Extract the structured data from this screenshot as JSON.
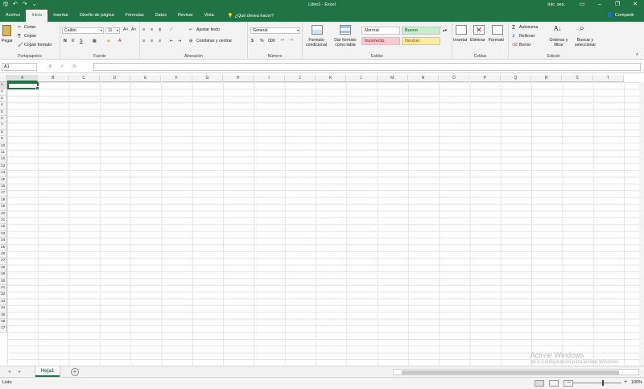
{
  "window": {
    "title": "Libro1  -  Excel",
    "user": "Inic. ses."
  },
  "tabs": [
    {
      "label": "Archivo"
    },
    {
      "label": "Inicio"
    },
    {
      "label": "Insertar"
    },
    {
      "label": "Diseño de página"
    },
    {
      "label": "Fórmulas"
    },
    {
      "label": "Datos"
    },
    {
      "label": "Revisar"
    },
    {
      "label": "Vista"
    }
  ],
  "tellme": "¿Qué desea hacer?",
  "share": "Compartir",
  "ribbon": {
    "clipboard": {
      "paste": "Pegar",
      "cut": "Cortar",
      "copy": "Copiar",
      "format_painter": "Copiar formato",
      "label": "Portapapeles"
    },
    "font": {
      "name": "Calibri",
      "size": "11",
      "bold": "N",
      "italic": "K",
      "underline": "S",
      "label": "Fuente"
    },
    "alignment": {
      "wrap": "Ajustar texto",
      "merge": "Combinar y centrar",
      "label": "Alineación"
    },
    "number": {
      "format": "General",
      "currency": "$",
      "percent": "%",
      "thousands": "000",
      "label": "Número"
    },
    "styles": {
      "cond_format": "Formato condicional",
      "table_format": "Dar formato como tabla",
      "normal": "Normal",
      "good": "Bueno",
      "bad": "Incorrecto",
      "neutral": "Neutral",
      "label": "Estilos"
    },
    "cells": {
      "insert": "Insertar",
      "delete": "Eliminar",
      "format": "Formato",
      "label": "Celdas"
    },
    "editing": {
      "autosum": "Autosuma",
      "fill": "Rellenar",
      "clear": "Borrar",
      "sort": "Ordenar y filtrar",
      "find": "Buscar y seleccionar",
      "label": "Edición"
    }
  },
  "colors": {
    "brand": "#217346",
    "good_bg": "#c6efce",
    "bad_bg": "#ffc7ce",
    "neutral_bg": "#ffeb9c"
  },
  "formula_bar": {
    "name_box": "A1",
    "cancel": "✕",
    "enter": "✓",
    "fx": "fx",
    "value": ""
  },
  "columns": [
    "A",
    "B",
    "C",
    "D",
    "E",
    "F",
    "G",
    "H",
    "I",
    "J",
    "K",
    "L",
    "M",
    "N",
    "O",
    "P",
    "Q",
    "R",
    "S",
    "T"
  ],
  "rows": [
    "1",
    "2",
    "3",
    "4",
    "5",
    "6",
    "7",
    "8",
    "9",
    "10",
    "11",
    "12",
    "13",
    "14",
    "15",
    "16",
    "17",
    "18",
    "19",
    "20",
    "21",
    "22",
    "23",
    "24",
    "25",
    "26",
    "27",
    "28",
    "29",
    "30",
    "31",
    "32",
    "33",
    "34",
    "35",
    "36",
    "37"
  ],
  "active_cell": "A1",
  "sheets": [
    {
      "label": "Hoja1",
      "active": true
    }
  ],
  "status": {
    "text": "Listo",
    "zoom": "100%"
  },
  "watermark": {
    "line1": "Activar Windows",
    "line2": "Ve a Configuración para activar Windows."
  }
}
